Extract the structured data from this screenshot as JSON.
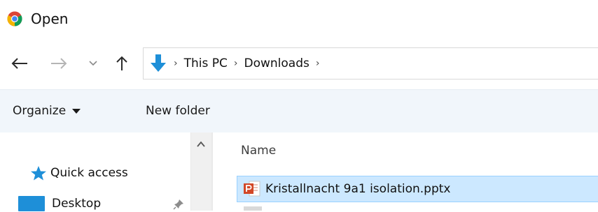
{
  "window": {
    "title": "Open",
    "app_icon": "chrome-icon"
  },
  "nav": {
    "back_icon": "arrow-left-icon",
    "forward_icon": "arrow-right-icon",
    "recent_icon": "chevron-down-icon",
    "up_icon": "arrow-up-icon",
    "location_icon": "downloads-icon",
    "breadcrumbs": [
      {
        "label": "This PC"
      },
      {
        "label": "Downloads"
      }
    ],
    "separator": "›"
  },
  "toolbar": {
    "organize_label": "Organize",
    "new_folder_label": "New folder"
  },
  "sidebar": {
    "items": [
      {
        "label": "Quick access",
        "icon": "star-icon"
      },
      {
        "label": "Desktop",
        "icon": "desktop-folder-icon",
        "pinned": true
      }
    ]
  },
  "file_list": {
    "columns": [
      {
        "label": "Name"
      }
    ],
    "rows": [
      {
        "name": "Kristallnacht 9a1 isolation.pptx",
        "icon": "powerpoint-file-icon",
        "selected": true
      }
    ]
  },
  "colors": {
    "command_bar_bg": "#f1f6fb",
    "selection_bg": "#cce8ff",
    "selection_border": "#99d1ff",
    "accent": "#1e8fd8"
  }
}
